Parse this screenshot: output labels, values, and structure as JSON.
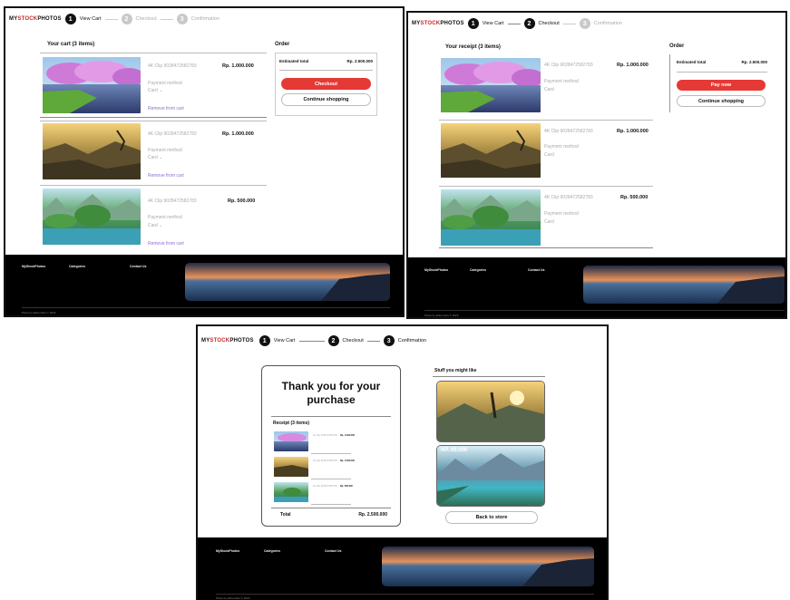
{
  "brand": {
    "prefix": "MY",
    "accent": "STOCK",
    "suffix": "PHOTOS",
    "accent_color": "#c62828"
  },
  "steps": [
    {
      "number": "1",
      "label": "View Cart"
    },
    {
      "number": "2",
      "label": "Checkout"
    },
    {
      "number": "3",
      "label": "Confirmation"
    }
  ],
  "screen1": {
    "cart_title": "Your cart (3 items)",
    "order_title": "Order",
    "estimated_label": "Estimated total",
    "estimated_value": "Rp. 2.500.000",
    "checkout_button": "Checkout",
    "continue_button": "Continue shopping"
  },
  "screen2": {
    "cart_title": "Your receipt (3 items)",
    "order_title": "Order",
    "estimated_label": "Estimated total",
    "estimated_value": "Rp. 2.500.000",
    "pay_button": "Pay now",
    "continue_button": "Continue shopping"
  },
  "screen3": {
    "thank_you": "Thank you for your purchase",
    "receipt_title": "Receipt (3 items)",
    "total_label": "Total",
    "total_value": "Rp. 2.500.000",
    "suggest_title": "Stuff you might like",
    "suggest_price": "RP. 00.000",
    "back_button": "Back to store"
  },
  "items": [
    {
      "code": "4K Clip  9028472582783",
      "price": "Rp. 1.000.000",
      "payment_label": "Payment method",
      "payment_value": "Card",
      "remove": "Remove from cart"
    },
    {
      "code": "4K Clip  9028472582783",
      "price": "Rp. 1.000.000",
      "payment_label": "Payment method",
      "payment_value": "Card",
      "remove": "Remove from cart"
    },
    {
      "code": "4K Clip  9028472582783",
      "price": "Rp. 500.000",
      "payment_label": "Payment method",
      "payment_value": "Card",
      "remove": "Remove from cart"
    }
  ],
  "footer": {
    "col1_title": "MyStockPhotos",
    "col2_title": "Categories",
    "col3_title": "Contact Us",
    "copyright": "Photo by alchemists © 2023"
  },
  "colors": {
    "primary_button": "#e53935",
    "link": "#8e6bd6",
    "footer_bg": "#000000"
  }
}
